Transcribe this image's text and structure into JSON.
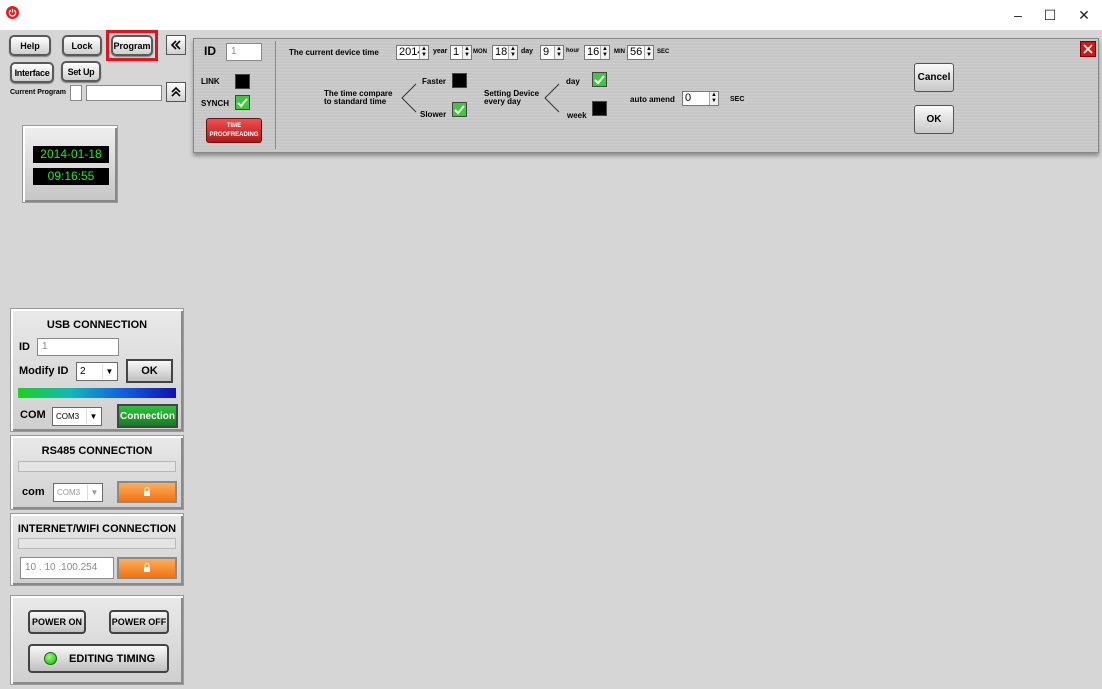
{
  "window": {
    "minimize_glyph": "–",
    "maximize_glyph": "☐",
    "close_glyph": "✕"
  },
  "left": {
    "buttons": {
      "help": "Help",
      "lock": "Lock",
      "program": "Program",
      "interface": "Interface",
      "setup": "Set Up"
    },
    "current_program_label": "Current Program",
    "clock": {
      "date": "2014-01-18",
      "time": "09:16:55"
    },
    "usb": {
      "title": "USB CONNECTION",
      "id_label": "ID",
      "id_value": "1",
      "modify_id_label": "Modify ID",
      "modify_id_value": "2",
      "ok_label": "OK",
      "com_label": "COM",
      "com_value": "COM3",
      "connection_label": "Connection"
    },
    "rs485": {
      "title": "RS485 CONNECTION",
      "com_label": "com",
      "com_value": "COM3"
    },
    "internet": {
      "title": "INTERNET/WIFI CONNECTION",
      "ip_value": "10 . 10 .100.254"
    },
    "power": {
      "power_on": "POWER ON",
      "power_off": "POWER OFF",
      "editing_timing": "EDITING TIMING"
    }
  },
  "time_panel": {
    "id_label": "ID",
    "id_value": "1",
    "current_time_label": "The current device time",
    "year_value": "2014",
    "year_label": "year",
    "month_value": "1",
    "month_label": "MON",
    "day_value": "18",
    "day_label": "day",
    "hour_value": "9",
    "hour_label": "hour",
    "min_value": "16",
    "min_label": "MIN",
    "sec_value": "56",
    "sec_label": "SEC",
    "link_label": "LINK",
    "synch_label": "SYNCH",
    "proofreading_line1": "TIME",
    "proofreading_line2": "PROOFREADING",
    "compare_line1": "The time compare",
    "compare_line2": "to standard time",
    "faster_label": "Faster",
    "slower_label": "Slower",
    "setting_line1": "Setting Device",
    "setting_line2": "every day",
    "day_option_label": "day",
    "week_option_label": "week",
    "auto_amend_label": "auto amend",
    "auto_amend_value": "0",
    "auto_amend_unit": "SEC",
    "cancel_label": "Cancel",
    "ok_label": "OK"
  },
  "colors": {
    "clock_text": "#27e827",
    "close_red": "#d01818",
    "connection_green": "#1f9a2c",
    "orange": "#f07414"
  }
}
